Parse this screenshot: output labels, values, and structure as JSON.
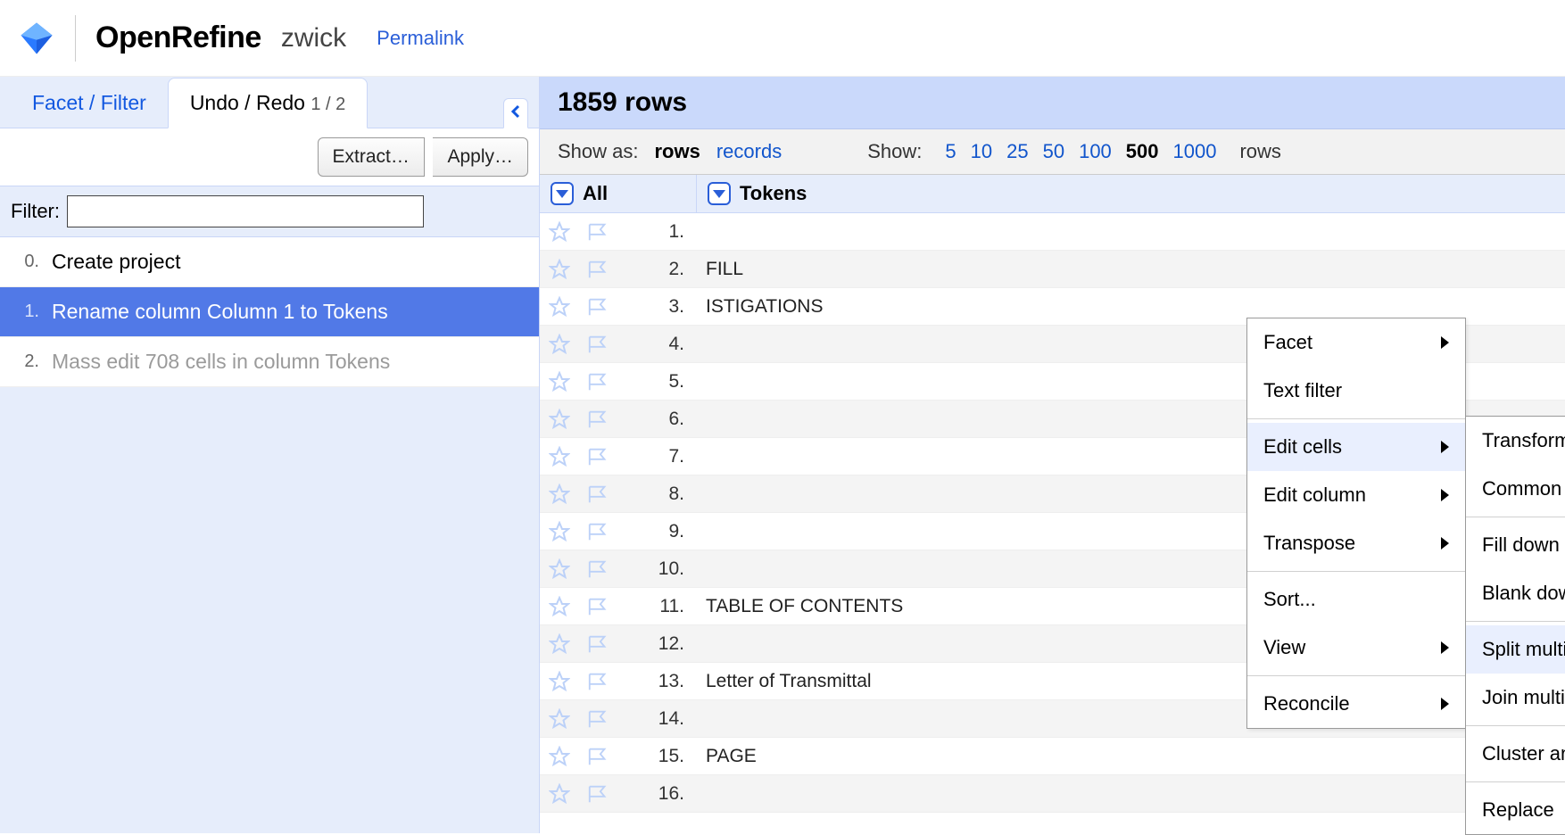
{
  "header": {
    "app_name": "OpenRefine",
    "project_name": "zwick",
    "permalink_label": "Permalink"
  },
  "sidebar": {
    "tabs": {
      "facet_filter": "Facet / Filter",
      "undo_redo": "Undo / Redo",
      "undo_redo_count": "1 / 2"
    },
    "toolbar": {
      "extract_label": "Extract…",
      "apply_label": "Apply…"
    },
    "filter_label": "Filter:",
    "filter_value": "",
    "history": [
      {
        "num": "0.",
        "label": "Create project",
        "state": "past"
      },
      {
        "num": "1.",
        "label": "Rename column Column 1 to Tokens",
        "state": "current"
      },
      {
        "num": "2.",
        "label": "Mass edit 708 cells in column Tokens",
        "state": "future"
      }
    ]
  },
  "main": {
    "row_count_label": "1859 rows",
    "show_as_label": "Show as:",
    "show_as_rows": "rows",
    "show_as_records": "records",
    "show_label": "Show:",
    "page_sizes": [
      "5",
      "10",
      "25",
      "50",
      "100",
      "500",
      "1000"
    ],
    "page_size_selected": "500",
    "rows_suffix": "rows",
    "columns": {
      "all_label": "All",
      "tokens_label": "Tokens"
    },
    "rows": [
      {
        "n": "1.",
        "v": ""
      },
      {
        "n": "2.",
        "v": "FILL"
      },
      {
        "n": "3.",
        "v": "ISTIGATIONS"
      },
      {
        "n": "4.",
        "v": ""
      },
      {
        "n": "5.",
        "v": ""
      },
      {
        "n": "6.",
        "v": ""
      },
      {
        "n": "7.",
        "v": ""
      },
      {
        "n": "8.",
        "v": ""
      },
      {
        "n": "9.",
        "v": ""
      },
      {
        "n": "10.",
        "v": ""
      },
      {
        "n": "11.",
        "v": "TABLE OF CONTENTS"
      },
      {
        "n": "12.",
        "v": ""
      },
      {
        "n": "13.",
        "v": "Letter of Transmittal"
      },
      {
        "n": "14.",
        "v": ""
      },
      {
        "n": "15.",
        "v": "PAGE"
      },
      {
        "n": "16.",
        "v": ""
      }
    ]
  },
  "menu_col": {
    "items": [
      {
        "label": "Facet",
        "submenu": true
      },
      {
        "label": "Text filter",
        "submenu": false
      },
      {
        "sep": true
      },
      {
        "label": "Edit cells",
        "submenu": true,
        "hovered": true
      },
      {
        "label": "Edit column",
        "submenu": true
      },
      {
        "label": "Transpose",
        "submenu": true
      },
      {
        "sep": true
      },
      {
        "label": "Sort...",
        "submenu": false
      },
      {
        "label": "View",
        "submenu": true
      },
      {
        "sep": true
      },
      {
        "label": "Reconcile",
        "submenu": true
      }
    ]
  },
  "menu_sub": {
    "items": [
      {
        "label": "Transform...",
        "submenu": false
      },
      {
        "label": "Common transforms",
        "submenu": true
      },
      {
        "sep": true
      },
      {
        "label": "Fill down",
        "submenu": false
      },
      {
        "label": "Blank down",
        "submenu": false
      },
      {
        "sep": true
      },
      {
        "label": "Split multi-valued cells...",
        "submenu": false,
        "hovered": true
      },
      {
        "label": "Join multi-valued cells...",
        "submenu": false
      },
      {
        "sep": true
      },
      {
        "label": "Cluster and edit...",
        "submenu": false
      },
      {
        "sep": true
      },
      {
        "label": "Replace",
        "submenu": false
      }
    ]
  }
}
